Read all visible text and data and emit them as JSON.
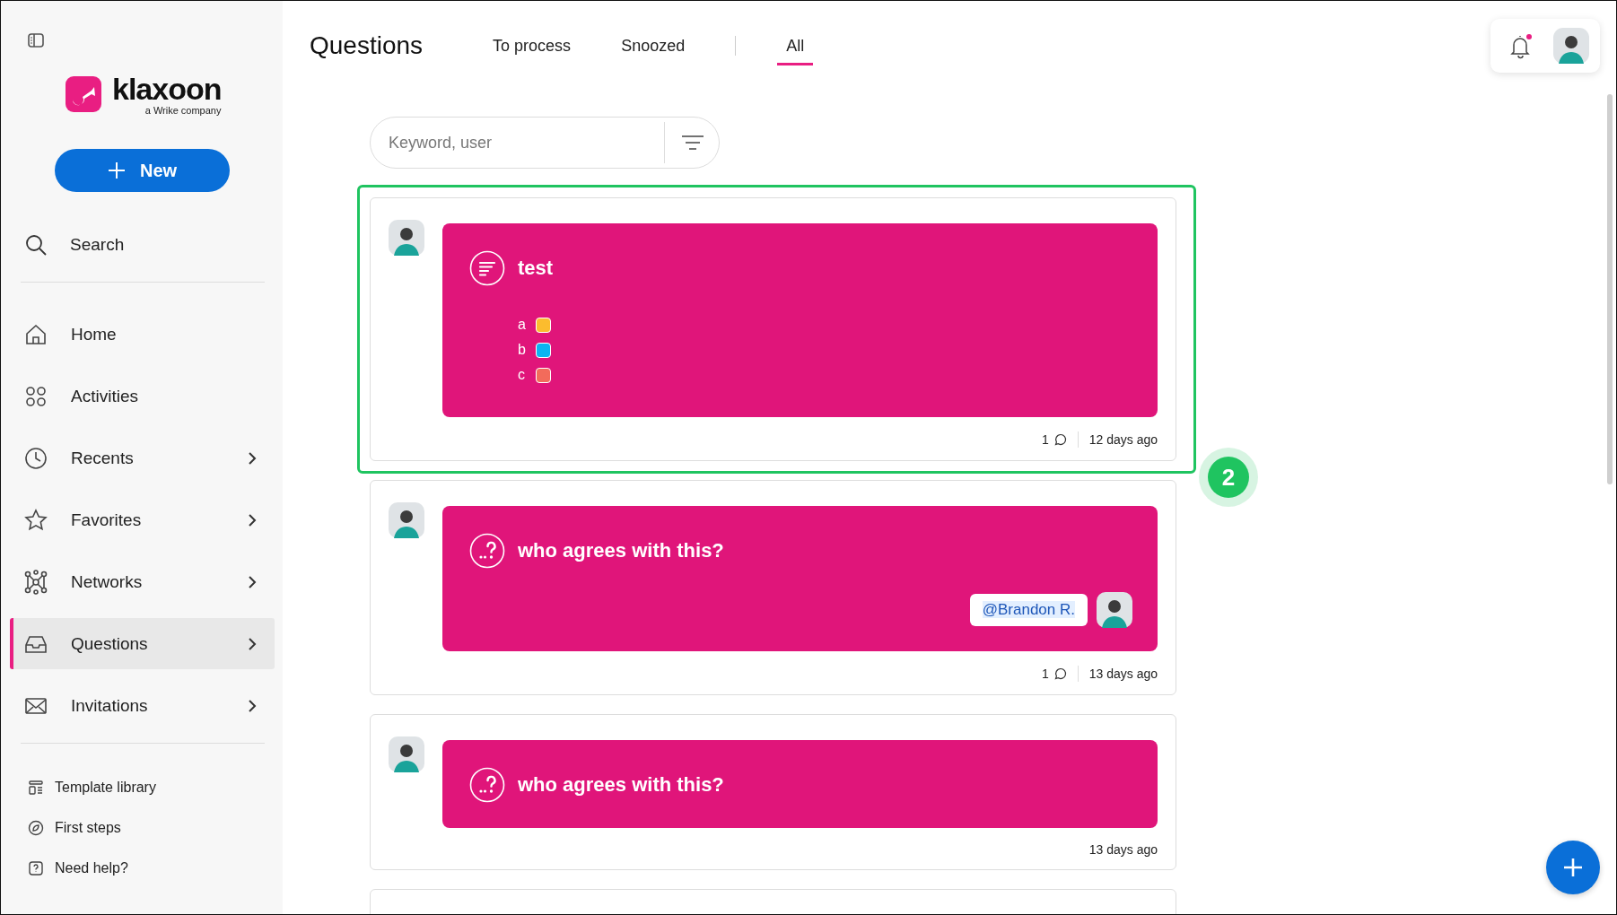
{
  "sidebar": {
    "logo": {
      "name": "klaxoon",
      "tagline": "a Wrike company"
    },
    "new_button": "New",
    "search": "Search",
    "items": [
      {
        "label": "Home",
        "chevron": false,
        "selected": false
      },
      {
        "label": "Activities",
        "chevron": false,
        "selected": false
      },
      {
        "label": "Recents",
        "chevron": true,
        "selected": false
      },
      {
        "label": "Favorites",
        "chevron": true,
        "selected": false
      },
      {
        "label": "Networks",
        "chevron": true,
        "selected": false
      },
      {
        "label": "Questions",
        "chevron": true,
        "selected": true
      },
      {
        "label": "Invitations",
        "chevron": true,
        "selected": false
      }
    ],
    "footer": [
      {
        "label": "Template library"
      },
      {
        "label": "First steps"
      },
      {
        "label": "Need help?"
      }
    ]
  },
  "page": {
    "title": "Questions",
    "tabs": [
      {
        "label": "To process",
        "selected": false
      },
      {
        "label": "Snoozed",
        "selected": false
      },
      {
        "label": "All",
        "selected": true
      }
    ],
    "notifications": {
      "unread": true
    },
    "search": {
      "placeholder": "Keyword, user"
    },
    "cards": [
      {
        "kind": "poll",
        "highlighted": true,
        "step": "2",
        "title": "test",
        "options": [
          {
            "label": "a",
            "color": "#fbbc2e"
          },
          {
            "label": "b",
            "color": "#0cb4f2"
          },
          {
            "label": "c",
            "color": "#f26b5b"
          }
        ],
        "comments": "1",
        "time": "12 days ago"
      },
      {
        "kind": "question",
        "highlighted": false,
        "title": "who agrees with this?",
        "mention": "@Brandon R.",
        "comments": "1",
        "time": "13 days ago"
      },
      {
        "kind": "question",
        "highlighted": false,
        "title": "who agrees with this?",
        "time": "13 days ago"
      },
      {
        "kind": "partial",
        "highlighted": false
      }
    ]
  }
}
